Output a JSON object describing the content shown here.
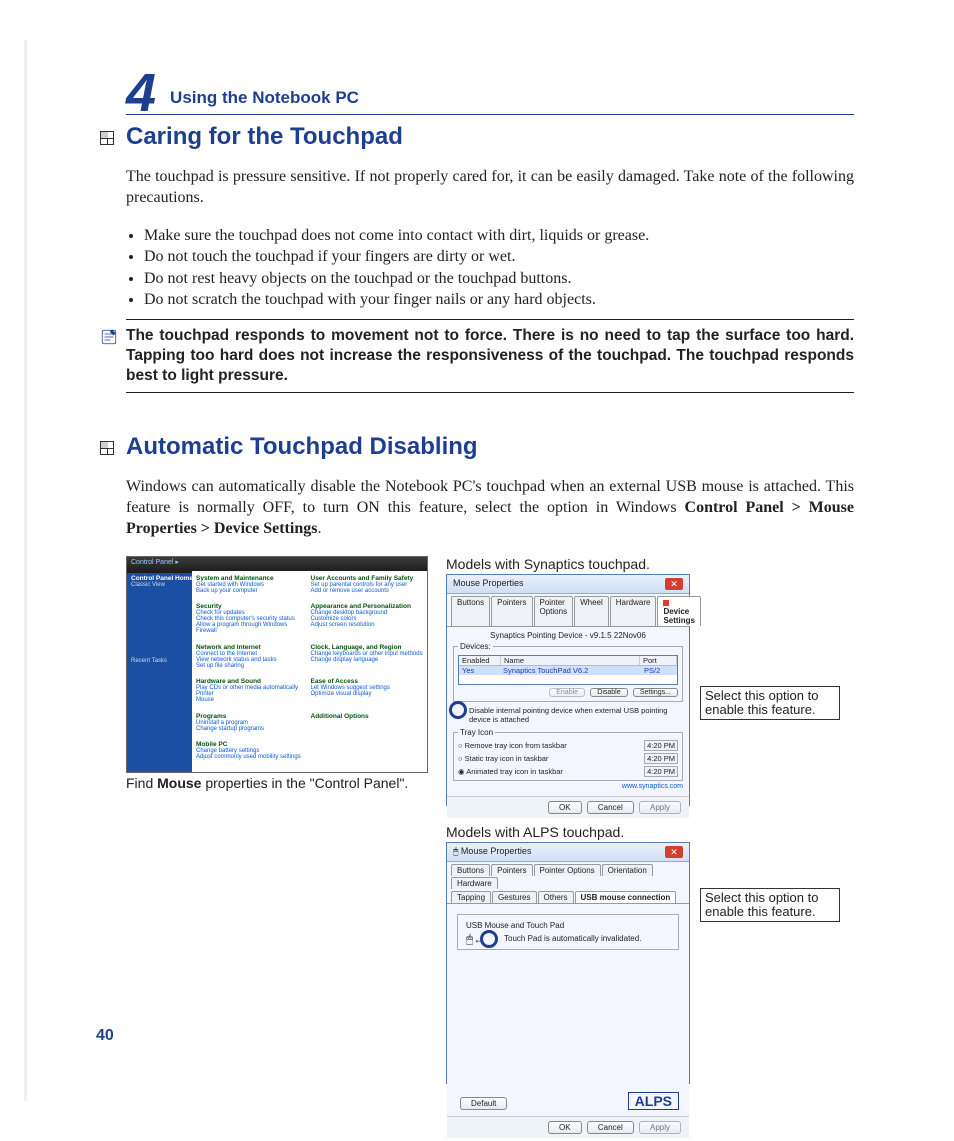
{
  "chapter": {
    "number": "4",
    "title": "Using the Notebook PC"
  },
  "section1": {
    "title": "Caring for the Touchpad",
    "intro": "The touchpad is pressure sensitive. If not properly cared for, it can be easily damaged. Take note of the following precautions.",
    "bullets": [
      "Make sure the touchpad does not come into contact with dirt, liquids or grease.",
      "Do not touch the touchpad if your fingers are dirty or wet.",
      "Do not rest heavy objects on the touchpad or the touchpad buttons.",
      "Do not scratch the touchpad with your finger nails or any hard objects."
    ],
    "note": "The touchpad responds to movement not to force. There is no need to tap the surface too hard. Tapping too hard does not increase the responsiveness of the touchpad. The touchpad responds best to light pressure."
  },
  "section2": {
    "title": "Automatic Touchpad Disabling",
    "intro_pre": "Windows can automatically disable the Notebook PC's touchpad when an external USB mouse is attached. This feature is normally OFF, to turn ON this feature, select the option in Windows ",
    "intro_bold": "Control Panel > Mouse Properties > Device Settings",
    "intro_post": "."
  },
  "figures": {
    "control_panel_caption_pre": "Find ",
    "control_panel_caption_bold": "Mouse",
    "control_panel_caption_post": " properties in the \"Control Panel\".",
    "synaptics_heading": "Models with Synaptics touchpad.",
    "alps_heading": "Models with ALPS touchpad.",
    "callout": "Select this option to enable this feature."
  },
  "control_panel": {
    "breadcrumb": "Control Panel ▸",
    "side_title": "Control Panel Home",
    "side_link": "Classic View",
    "recent_tasks": "Recent Tasks",
    "items_left": [
      {
        "title": "System and Maintenance",
        "l1": "Get started with Windows",
        "l2": "Back up your computer"
      },
      {
        "title": "Security",
        "l1": "Check for updates",
        "l2": "Check this computer's security status",
        "l3": "Allow a program through Windows Firewall"
      },
      {
        "title": "Network and Internet",
        "l1": "Connect to the Internet",
        "l2": "View network status and tasks",
        "l3": "Set up file sharing"
      },
      {
        "title": "Hardware and Sound",
        "l1": "Play CDs or other media automatically",
        "l2": "Printer",
        "l3": "Mouse"
      },
      {
        "title": "Programs",
        "l1": "Uninstall a program",
        "l2": "Change startup programs"
      },
      {
        "title": "Mobile PC",
        "l1": "Change battery settings",
        "l2": "Adjust commonly used mobility settings"
      }
    ],
    "items_right": [
      {
        "title": "User Accounts and Family Safety",
        "l1": "Set up parental controls for any user",
        "l2": "Add or remove user accounts"
      },
      {
        "title": "Appearance and Personalization",
        "l1": "Change desktop background",
        "l2": "Customize colors",
        "l3": "Adjust screen resolution"
      },
      {
        "title": "Clock, Language, and Region",
        "l1": "Change keyboards or other input methods",
        "l2": "Change display language"
      },
      {
        "title": "Ease of Access",
        "l1": "Let Windows suggest settings",
        "l2": "Optimize visual display"
      },
      {
        "title": "Additional Options",
        "l1": "",
        "l2": ""
      }
    ]
  },
  "synaptics": {
    "title": "Mouse Properties",
    "tabs": [
      "Buttons",
      "Pointers",
      "Pointer Options",
      "Wheel",
      "Hardware"
    ],
    "active_tab": "Device Settings",
    "version_line": "Synaptics Pointing Device - v9.1.5 22Nov06",
    "devices_label": "Devices:",
    "cols": {
      "enabled": "Enabled",
      "name": "Name",
      "port": "Port"
    },
    "row": {
      "enabled": "Yes",
      "name": "Synaptics TouchPad V6.2",
      "port": "PS/2"
    },
    "btn_enable": "Enable",
    "btn_disable": "Disable",
    "btn_settings": "Settings...",
    "disable_checkbox": "Disable internal pointing device when external USB pointing device is attached",
    "tray_legend": "Tray Icon",
    "radios": [
      "Remove tray icon from taskbar",
      "Static tray icon in taskbar",
      "Animated tray icon in taskbar"
    ],
    "time": "4:20 PM",
    "link": "www.synaptics.com",
    "ok": "OK",
    "cancel": "Cancel",
    "apply": "Apply"
  },
  "alps": {
    "title": "Mouse Properties",
    "tabs_top": [
      "Buttons",
      "Pointers",
      "Pointer Options",
      "Orientation",
      "Hardware"
    ],
    "tabs_bottom": [
      "Tapping",
      "Gestures",
      "Others"
    ],
    "active_tab": "USB mouse connection",
    "group_label": "USB Mouse and Touch Pad",
    "checkbox_label": "Touch Pad is automatically invalidated.",
    "logo": "ALPS",
    "default_btn": "Default",
    "ok": "OK",
    "cancel": "Cancel",
    "apply": "Apply"
  },
  "page_number": "40"
}
